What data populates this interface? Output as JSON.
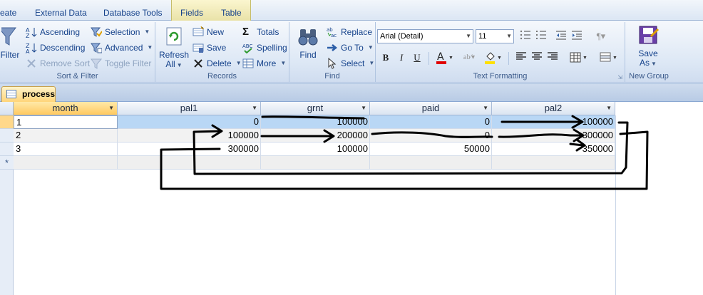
{
  "tabs": {
    "create": "eate",
    "external_data": "External Data",
    "database_tools": "Database Tools",
    "fields": "Fields",
    "table": "Table"
  },
  "ribbon": {
    "sort_filter": {
      "filter": "Filter",
      "ascending": "Ascending",
      "descending": "Descending",
      "remove_sort": "Remove Sort",
      "selection": "Selection",
      "advanced": "Advanced",
      "toggle_filter": "Toggle Filter",
      "label": "Sort & Filter"
    },
    "records": {
      "refresh": "Refresh",
      "refresh_all": "All",
      "new": "New",
      "save": "Save",
      "delete": "Delete",
      "totals": "Totals",
      "spelling": "Spelling",
      "more": "More",
      "label": "Records"
    },
    "find": {
      "find": "Find",
      "replace": "Replace",
      "goto": "Go To",
      "select": "Select",
      "label": "Find"
    },
    "text_formatting": {
      "font_name": "Arial (Detail)",
      "font_size": "11",
      "label": "Text Formatting",
      "bold": "B",
      "italic": "I",
      "underline": "U",
      "font_color": "#e00000",
      "fill_color": "#ffe000"
    },
    "new_group": {
      "save_as_line1": "Save",
      "save_as_line2": "As",
      "label": "New Group"
    }
  },
  "document": {
    "tab_name": "process"
  },
  "datasheet": {
    "columns": [
      "month",
      "pal1",
      "grnt",
      "paid",
      "pal2"
    ],
    "rows": [
      [
        "1",
        "0",
        "100000",
        "0",
        "100000"
      ],
      [
        "2",
        "100000",
        "200000",
        "0",
        "300000"
      ],
      [
        "3",
        "300000",
        "100000",
        "50000",
        "350000"
      ]
    ],
    "new_row_marker": "*"
  }
}
